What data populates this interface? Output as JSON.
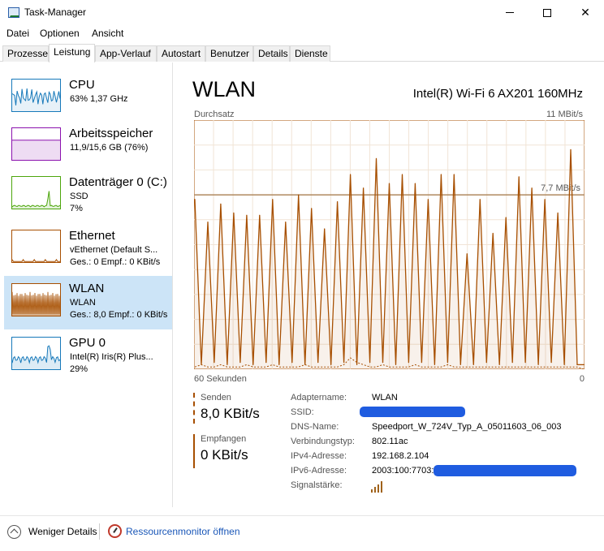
{
  "window": {
    "title": "Task-Manager"
  },
  "menu": [
    "Datei",
    "Optionen",
    "Ansicht"
  ],
  "tabs": [
    "Prozesse",
    "Leistung",
    "App-Verlauf",
    "Autostart",
    "Benutzer",
    "Details",
    "Dienste"
  ],
  "active_tab": "Leistung",
  "sidebar": [
    {
      "name": "CPU",
      "lines": [
        "63%  1,37 GHz"
      ],
      "color": "#1779ba"
    },
    {
      "name": "Arbeitsspeicher",
      "lines": [
        "11,9/15,6 GB (76%)"
      ],
      "color": "#8b12ae"
    },
    {
      "name": "Datenträger 0 (C:)",
      "lines": [
        "SSD",
        "7%"
      ],
      "color": "#4da60c"
    },
    {
      "name": "Ethernet",
      "lines": [
        "vEthernet (Default S...",
        "Ges.: 0  Empf.: 0 KBit/s"
      ],
      "color": "#a74f01"
    },
    {
      "name": "WLAN",
      "lines": [
        "WLAN",
        "Ges.: 8,0  Empf.: 0 KBit/s"
      ],
      "color": "#a74f01"
    },
    {
      "name": "GPU 0",
      "lines": [
        "Intel(R) Iris(R) Plus...",
        "29%"
      ],
      "color": "#1779ba"
    }
  ],
  "selected_item": "WLAN",
  "main": {
    "title": "WLAN",
    "adapter": "Intel(R) Wi-Fi 6 AX201 160MHz",
    "graph_label": "Durchsatz",
    "graph_max": "11 MBit/s",
    "graph_ref_label": "7,7 MBit/s",
    "time_label": "60 Sekunden",
    "zero_label": "0",
    "send_label": "Senden",
    "send_value": "8,0 KBit/s",
    "recv_label": "Empfangen",
    "recv_value": "0 KBit/s"
  },
  "info": [
    {
      "key": "Adaptername:",
      "value": "WLAN",
      "redacted": false
    },
    {
      "key": "SSID:",
      "value": "",
      "redacted": true
    },
    {
      "key": "DNS-Name:",
      "value": "Speedport_W_724V_Typ_A_05011603_06_003",
      "redacted": false
    },
    {
      "key": "Verbindungstyp:",
      "value": "802.11ac",
      "redacted": false
    },
    {
      "key": "IPv4-Adresse:",
      "value": "192.168.2.104",
      "redacted": false
    },
    {
      "key": "IPv6-Adresse:",
      "value": "2003:100:7703:",
      "redacted": true
    },
    {
      "key": "Signalstärke:",
      "value": "",
      "redacted": false
    }
  ],
  "chart_data": {
    "type": "line",
    "title": "Durchsatz",
    "xlabel": "60 Sekunden",
    "ylabel": "",
    "ylim": [
      0,
      11
    ],
    "reference_line": 7.7,
    "series": [
      {
        "name": "Senden",
        "values": [
          7.5,
          0.2,
          6.5,
          0.3,
          7.3,
          0.2,
          6.9,
          0.3,
          6.8,
          0.2,
          6.8,
          0.3,
          7.5,
          0.2,
          6.5,
          0.3,
          7.7,
          0.2,
          7.1,
          0.3,
          6.2,
          0.2,
          7.4,
          0.3,
          8.6,
          0.2,
          8.0,
          0.3,
          9.3,
          0.3,
          8.2,
          0.2,
          8.6,
          0.3,
          8.2,
          0.3,
          7.5,
          0.2,
          8.6,
          0.3,
          8.6,
          0.2,
          5.1,
          0.2,
          7.5,
          0.3,
          6.0,
          0.2,
          6.7,
          0.3,
          8.5,
          0.3,
          8.0,
          0.2,
          7.5,
          0.3,
          6.9,
          0.2,
          9.7,
          0.2,
          0.2
        ]
      },
      {
        "name": "Empfangen",
        "values": [
          0.1,
          0.2,
          0.1,
          0.1,
          0.2,
          0.1,
          0.1,
          0.1,
          0.2,
          0.1,
          0.1,
          0.1,
          0.2,
          0.1,
          0.1,
          0.1,
          0.1,
          0.2,
          0.1,
          0.1,
          0.1,
          0.1,
          0.1,
          0.2,
          0.5,
          0.3,
          0.2,
          0.1,
          0.1,
          0.2,
          0.1,
          0.1,
          0.1,
          0.1,
          0.2,
          0.1,
          0.1,
          0.1,
          0.1,
          0.2,
          0.1,
          0.1,
          0.1,
          0.1,
          0.1,
          0.1,
          0.1,
          0.1,
          0.1,
          0.1,
          0.1,
          0.1,
          0.1,
          0.1,
          0.1,
          0.1,
          0.1,
          0.1,
          0.1,
          0.1,
          0.0
        ]
      }
    ]
  },
  "footer": {
    "fewer_details": "Weniger Details",
    "resource_monitor": "Ressourcenmonitor öffnen"
  }
}
